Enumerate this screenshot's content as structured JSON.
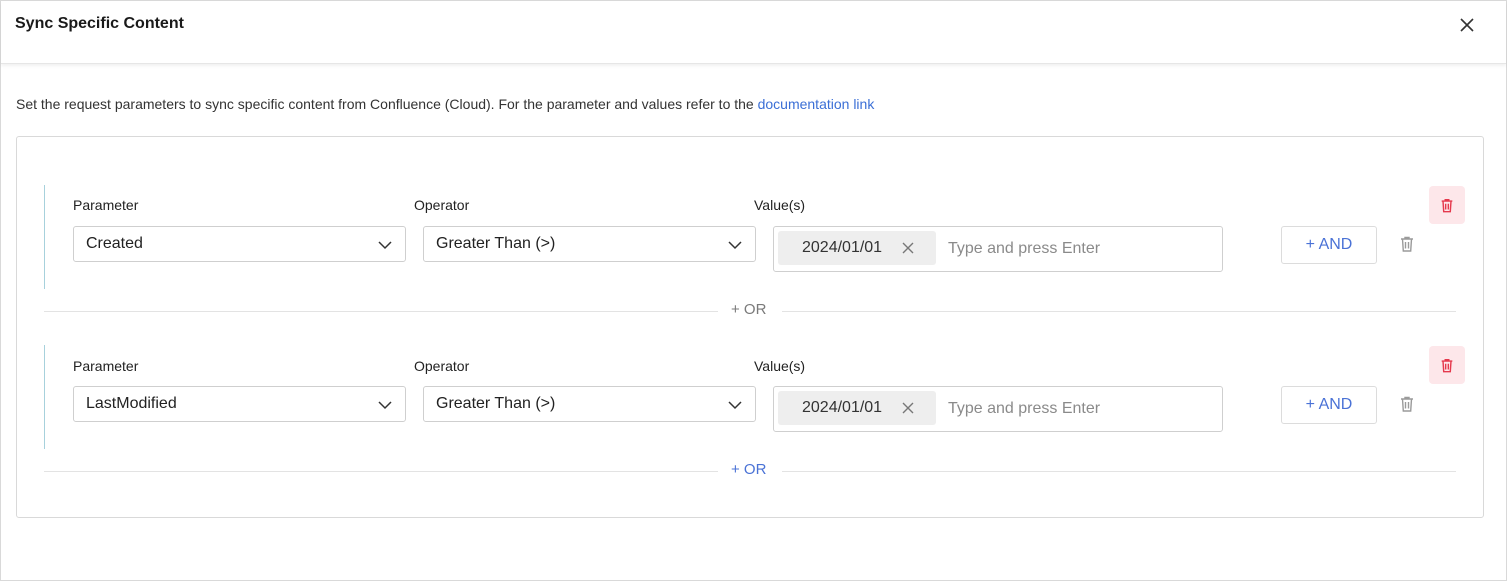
{
  "dialog": {
    "title": "Sync Specific Content",
    "description": "Set the request parameters to sync specific content from Confluence (Cloud). For the parameter and values refer to the ",
    "doc_link": "documentation link"
  },
  "colors": {
    "accent": "#4a72d6",
    "link": "#3b6fd6",
    "danger_bg": "#fde7ea",
    "danger": "#e5394d",
    "rail": "#a7d1dc"
  },
  "labels": {
    "parameter": "Parameter",
    "operator": "Operator",
    "values": "Value(s)"
  },
  "groups": [
    {
      "parameter": "Created",
      "operator": "Greater Than (>)",
      "chip": "2024/01/01",
      "placeholder": "Type and press Enter",
      "and_label": "+ AND"
    },
    {
      "parameter": "LastModified",
      "operator": "Greater Than (>)",
      "chip": "2024/01/01",
      "placeholder": "Type and press Enter",
      "and_label": "+ AND"
    }
  ],
  "or_dividers": [
    {
      "label": "+ OR",
      "state": "disabled"
    },
    {
      "label": "+ OR",
      "state": "active"
    }
  ],
  "icons": [
    "close-icon",
    "chevron-down-icon",
    "clear-chip-icon",
    "trash-icon"
  ]
}
